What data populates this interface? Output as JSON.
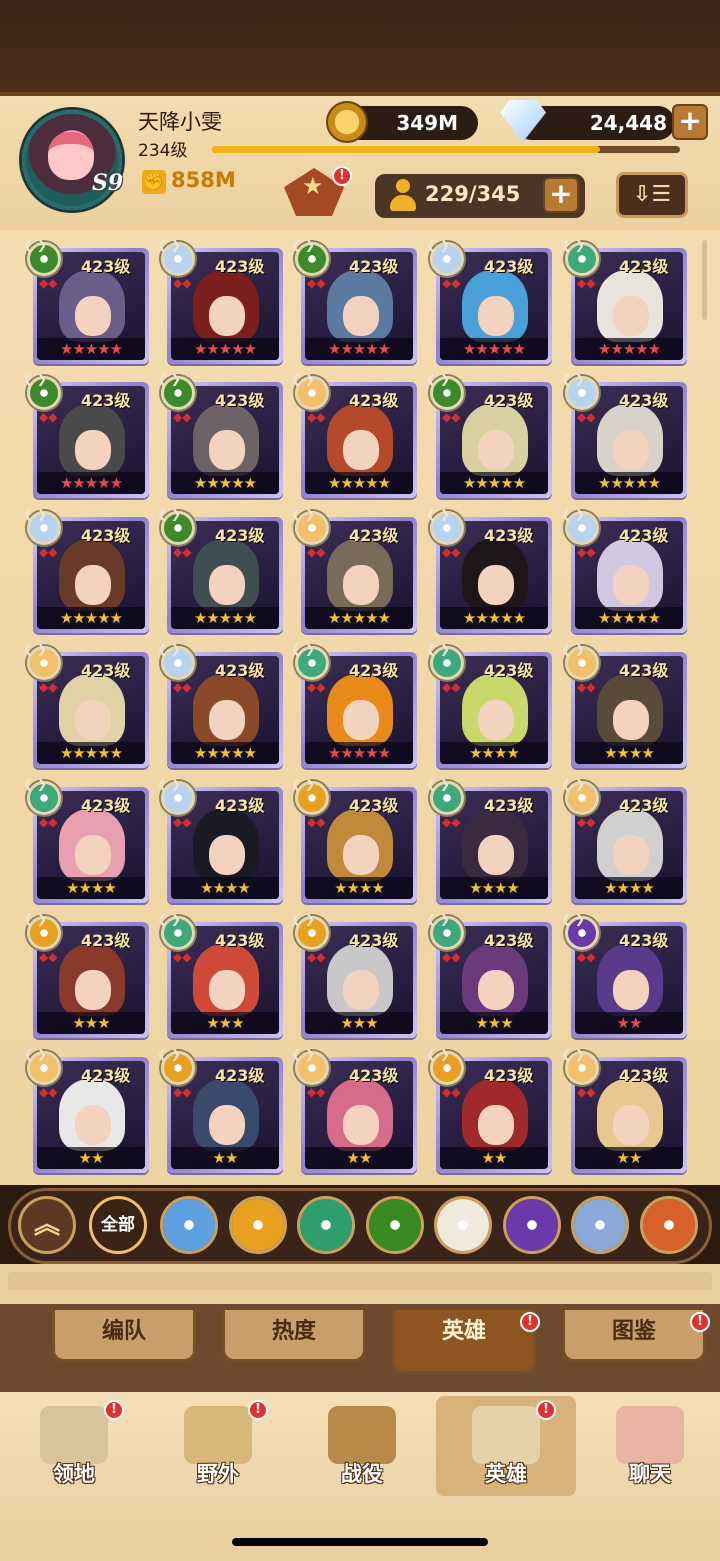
{
  "player": {
    "name": "天降小雯",
    "level": "234级",
    "server": "S9",
    "power": "858M",
    "xp_fraction": 0.83
  },
  "resources": {
    "gold": "349M",
    "diamonds": "24,448"
  },
  "roster": {
    "count": "229/345"
  },
  "icons": {
    "gold": "gold-coin-icon",
    "diamond": "diamond-icon",
    "power": "fist-icon",
    "roster": "person-icon",
    "sort": "sort-icon",
    "plus": "+"
  },
  "alert_mark": "!",
  "sort_glyph": "⇩☰",
  "heroes": [
    {
      "level": "423级",
      "stars": 5,
      "star_color": "#e94a4a",
      "faction": "graveborn",
      "portrait": "#6b5d8a"
    },
    {
      "level": "423级",
      "stars": 5,
      "star_color": "#e94a4a",
      "faction": "celestial",
      "portrait": "#7a1e1e"
    },
    {
      "level": "423级",
      "stars": 5,
      "star_color": "#e94a4a",
      "faction": "graveborn",
      "portrait": "#5c7aa0"
    },
    {
      "level": "423level",
      "stars": 5,
      "star_color": "#e94a4a",
      "faction": "celestial",
      "portrait": "#4aa0d8"
    },
    {
      "level": "423级",
      "stars": 5,
      "star_color": "#e94a4a",
      "faction": "wilder",
      "portrait": "#e8e4dc"
    },
    {
      "level": "423级",
      "stars": 5,
      "star_color": "#e94a4a",
      "faction": "graveborn",
      "portrait": "#4a4a4a"
    },
    {
      "level": "423级",
      "stars": 5,
      "star_color": "#f2c030",
      "faction": "graveborn",
      "portrait": "#6d6266"
    },
    {
      "level": "423级",
      "stars": 5,
      "star_color": "#f2c030",
      "faction": "lightbearer",
      "portrait": "#b44a2a"
    },
    {
      "level": "423级",
      "stars": 5,
      "star_color": "#f2c030",
      "faction": "graveborn",
      "portrait": "#d8d0a0"
    },
    {
      "level": "423级",
      "stars": 5,
      "star_color": "#f2c030",
      "faction": "celestial",
      "portrait": "#d8d2c8"
    },
    {
      "level": "423级",
      "stars": 5,
      "star_color": "#f2c030",
      "faction": "celestial",
      "portrait": "#6a3a28"
    },
    {
      "level": "423级",
      "stars": 5,
      "star_color": "#f2c030",
      "faction": "graveborn",
      "portrait": "#3f4e50"
    },
    {
      "level": "423级",
      "stars": 5,
      "star_color": "#f2c030",
      "faction": "lightbearer",
      "portrait": "#7a6a5a"
    },
    {
      "level": "423级",
      "stars": 5,
      "star_color": "#f2c030",
      "faction": "celestial",
      "portrait": "#1e1618"
    },
    {
      "level": "423级",
      "stars": 5,
      "star_color": "#f2c030",
      "faction": "celestial",
      "portrait": "#d0c8e0"
    },
    {
      "level": "423级",
      "stars": 5,
      "star_color": "#f2c030",
      "faction": "lightbearer",
      "portrait": "#e0d2a6"
    },
    {
      "level": "423级",
      "stars": 5,
      "star_color": "#f2c030",
      "faction": "celestial",
      "portrait": "#8a4a2a"
    },
    {
      "level": "423级",
      "stars": 5,
      "star_color": "#e94a4a",
      "faction": "wilder",
      "portrait": "#e88a1a"
    },
    {
      "level": "423级",
      "stars": 4,
      "star_color": "#f2c030",
      "faction": "wilder",
      "portrait": "#c8d86a"
    },
    {
      "level": "423级",
      "stars": 4,
      "star_color": "#f2c030",
      "faction": "lightbearer",
      "portrait": "#5a4a3a"
    },
    {
      "level": "423级",
      "stars": 4,
      "star_color": "#f2c030",
      "faction": "wilder",
      "portrait": "#e8a0b0"
    },
    {
      "level": "423级",
      "stars": 4,
      "star_color": "#f2c030",
      "faction": "celestial",
      "portrait": "#1a1a22"
    },
    {
      "level": "423级",
      "stars": 4,
      "star_color": "#f2c030",
      "faction": "mauler",
      "portrait": "#c08a3a"
    },
    {
      "level": "423级",
      "stars": 4,
      "star_color": "#f2c030",
      "faction": "wilder",
      "portrait": "#3a2a40"
    },
    {
      "level": "423级",
      "stars": 4,
      "star_color": "#f2c030",
      "faction": "lightbearer",
      "portrait": "#d0d0d0"
    },
    {
      "level": "423级",
      "stars": 3,
      "star_color": "#f2c030",
      "faction": "mauler",
      "portrait": "#8a3a2a"
    },
    {
      "level": "423级",
      "stars": 3,
      "star_color": "#f2c030",
      "faction": "wilder",
      "portrait": "#d04a3a"
    },
    {
      "level": "423级",
      "stars": 3,
      "star_color": "#f2c030",
      "faction": "mauler",
      "portrait": "#c8c8c8"
    },
    {
      "level": "423级",
      "stars": 3,
      "star_color": "#f2c030",
      "faction": "wilder",
      "portrait": "#6a3a7a"
    },
    {
      "level": "423级",
      "stars": 2,
      "star_color": "#e94a4a",
      "faction": "hypogean",
      "portrait": "#5a3a8a"
    },
    {
      "level": "423级",
      "stars": 2,
      "star_color": "#f2c030",
      "faction": "lightbearer",
      "portrait": "#e8e8e8"
    },
    {
      "level": "423级",
      "stars": 2,
      "star_color": "#f2c030",
      "faction": "mauler",
      "portrait": "#3a4a6a"
    },
    {
      "level": "423级",
      "stars": 2,
      "star_color": "#f2c030",
      "faction": "lightbearer",
      "portrait": "#d86a8a"
    },
    {
      "level": "423级",
      "stars": 2,
      "star_color": "#f2c030",
      "faction": "mauler",
      "portrait": "#a02a2a"
    },
    {
      "level": "423级",
      "stars": 2,
      "star_color": "#f2c030",
      "faction": "lightbearer",
      "portrait": "#e8c890"
    }
  ],
  "faction_colors": {
    "lightbearer": "#f2c06a",
    "celestial": "#b9d2ef",
    "graveborn": "#3d8a2a",
    "wilder": "#3ea87a",
    "mauler": "#e8a020",
    "hypogean": "#6a3aa8"
  },
  "filters": {
    "collapse_glyph": "︽",
    "all_label": "全部",
    "items": [
      {
        "name": "lightbearer-filter",
        "color": "#5ea0e0"
      },
      {
        "name": "mauler-filter",
        "color": "#e8a020"
      },
      {
        "name": "wilder-filter",
        "color": "#2e9e6a"
      },
      {
        "name": "graveborn-filter",
        "color": "#3a8a22"
      },
      {
        "name": "celestial-filter",
        "color": "#f0eadc"
      },
      {
        "name": "hypogean-filter",
        "color": "#6a3aa8"
      },
      {
        "name": "dimensional-filter",
        "color": "#8aa8d8"
      },
      {
        "name": "fire-filter",
        "color": "#d8602a"
      }
    ]
  },
  "sub_tabs": [
    {
      "label": "编队",
      "alert": false,
      "active": false
    },
    {
      "label": "热度",
      "alert": false,
      "active": false
    },
    {
      "label": "英雄",
      "alert": true,
      "active": true
    },
    {
      "label": "图鉴",
      "alert": true,
      "active": false
    }
  ],
  "nav": [
    {
      "label": "领地",
      "alert": true,
      "active": false,
      "icon": "castle-icon",
      "color": "#d8c49a"
    },
    {
      "label": "野外",
      "alert": true,
      "active": false,
      "icon": "map-scroll-icon",
      "color": "#d8b87a"
    },
    {
      "label": "战役",
      "alert": false,
      "active": false,
      "icon": "battle-wings-icon",
      "color": "#b88a4a"
    },
    {
      "label": "英雄",
      "alert": true,
      "active": true,
      "icon": "helmet-icon",
      "color": "#e6d2a8"
    },
    {
      "label": "聊天",
      "alert": false,
      "active": false,
      "icon": "chat-icon",
      "color": "#e6b4a0"
    }
  ]
}
